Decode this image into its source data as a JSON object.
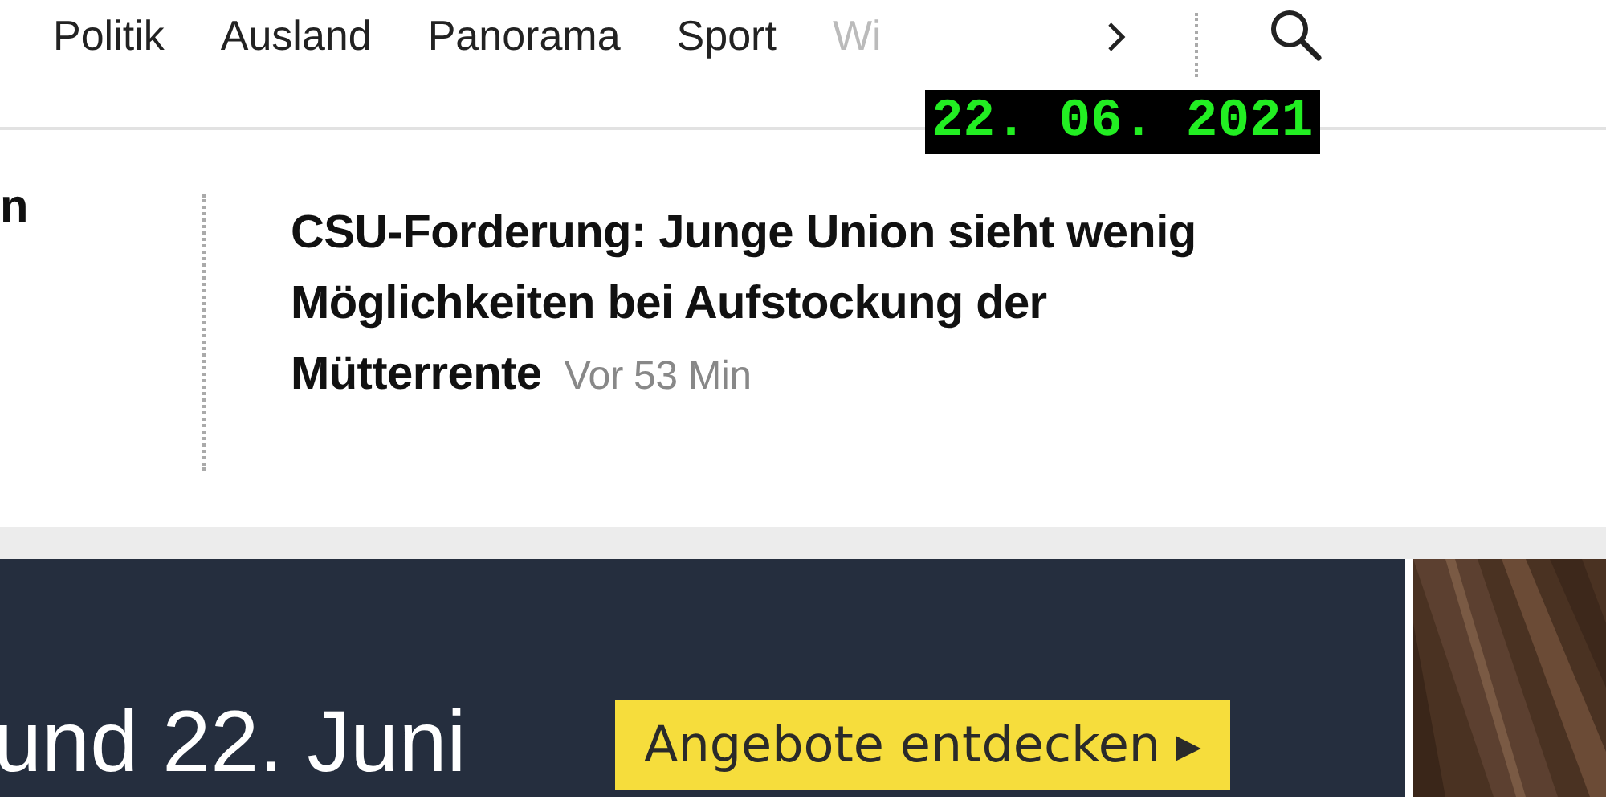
{
  "nav": {
    "items": [
      {
        "label": "Politik",
        "faded": false
      },
      {
        "label": "Ausland",
        "faded": false
      },
      {
        "label": "Panorama",
        "faded": false
      },
      {
        "label": "Sport",
        "faded": false
      },
      {
        "label": "Wi",
        "faded": true
      }
    ]
  },
  "date_stamp": "22. 06. 2021",
  "teasers": [
    {
      "headline": "n"
    },
    {
      "headline": "CSU-Forderung: Junge Union sieht wenig Möglichkeiten bei Aufstockung der Mütterrente",
      "time": "Vor 53 Min"
    }
  ],
  "ad_banner": {
    "text": "und 22. Juni",
    "button": "Angebote entdecken ▸"
  }
}
